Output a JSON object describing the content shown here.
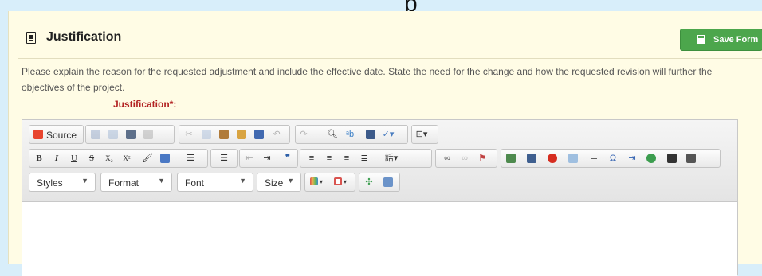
{
  "top_fragment": "p",
  "panel": {
    "title": "Justification",
    "title_icon": "document-icon",
    "save_button": {
      "label": "Save Form",
      "icon": "floppy-disk-icon",
      "color": "#4ca64c"
    },
    "instructions": "Please explain the reason for the requested adjustment and include the effective date. State the need for the change and how the requested revision will further the objectives of the project.",
    "field_label": "Justification*:",
    "field_label_color": "#b22222",
    "background": "#fffce5"
  },
  "editor": {
    "source_label": "Source",
    "combos": {
      "styles": "Styles",
      "format": "Format",
      "font": "Font",
      "size": "Size"
    },
    "formatting": {
      "bold": "B",
      "italic": "I",
      "underline": "U",
      "strike": "S",
      "subscript": "X₂",
      "superscript": "X²"
    },
    "blockquote": "❞",
    "omega": "Ω",
    "content": ""
  }
}
